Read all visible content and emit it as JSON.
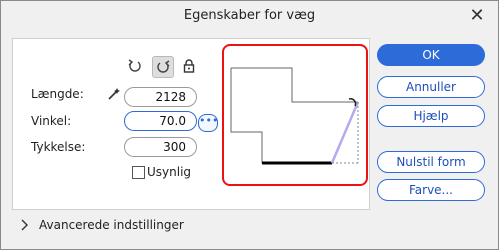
{
  "dialog": {
    "title": "Egenskaber for væg",
    "close_glyph": "✕"
  },
  "fields": {
    "length": {
      "label": "Længde:",
      "value": "2128"
    },
    "angle": {
      "label": "Vinkel:",
      "value": "70.0"
    },
    "thickness": {
      "label": "Tykkelse:",
      "value": "300"
    }
  },
  "invisible": {
    "label": "Usynlig",
    "checked": false
  },
  "buttons": {
    "ok": "OK",
    "cancel": "Annuller",
    "help": "Hjælp",
    "reset": "Nulstil form",
    "color": "Farve..."
  },
  "advanced": {
    "label": "Avancerede indstillinger",
    "expanded": false
  },
  "icons": [
    "rotate-left-icon",
    "rotate-right-icon",
    "lock-icon",
    "magic-wand-icon",
    "more-options-icon",
    "chevron-right-icon"
  ],
  "colors": {
    "accent": "#2c6bd8",
    "highlight": "#e11111",
    "wall": "#000000",
    "angle_line": "#b9a8f0"
  }
}
